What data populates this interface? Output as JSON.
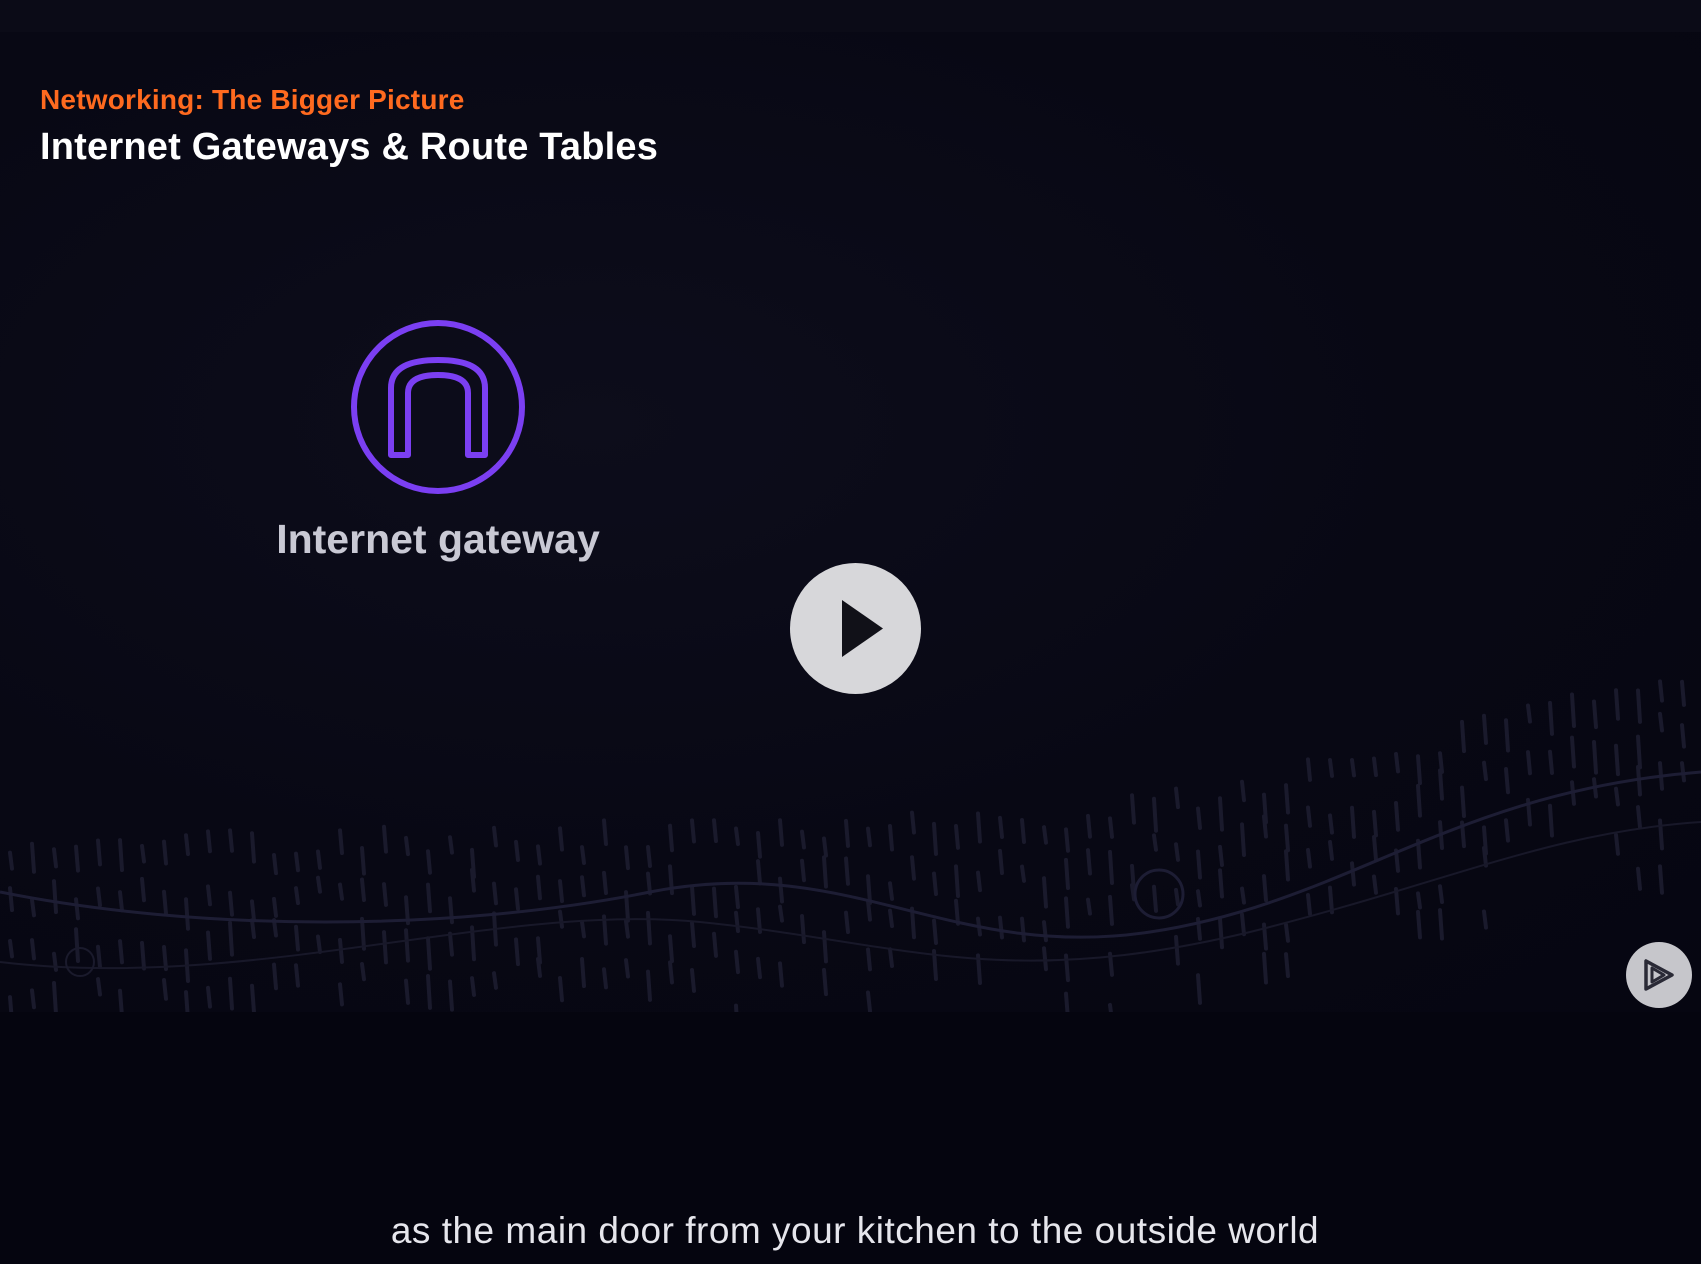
{
  "player": {
    "course_title": "Networking: The Bigger Picture",
    "clip_title": "Internet Gateways & Route Tables",
    "subtitle": "as the main door from your kitchen to the outside world"
  },
  "slide": {
    "icon": "internet-gateway-icon",
    "label": "Internet gateway",
    "icon_color": "#7b3ff2"
  },
  "controls": {
    "play_icon": "play-icon",
    "brand_icon": "pluralsight-logo-icon"
  },
  "colors": {
    "accent": "#ff6a1f",
    "background": "#060612"
  }
}
